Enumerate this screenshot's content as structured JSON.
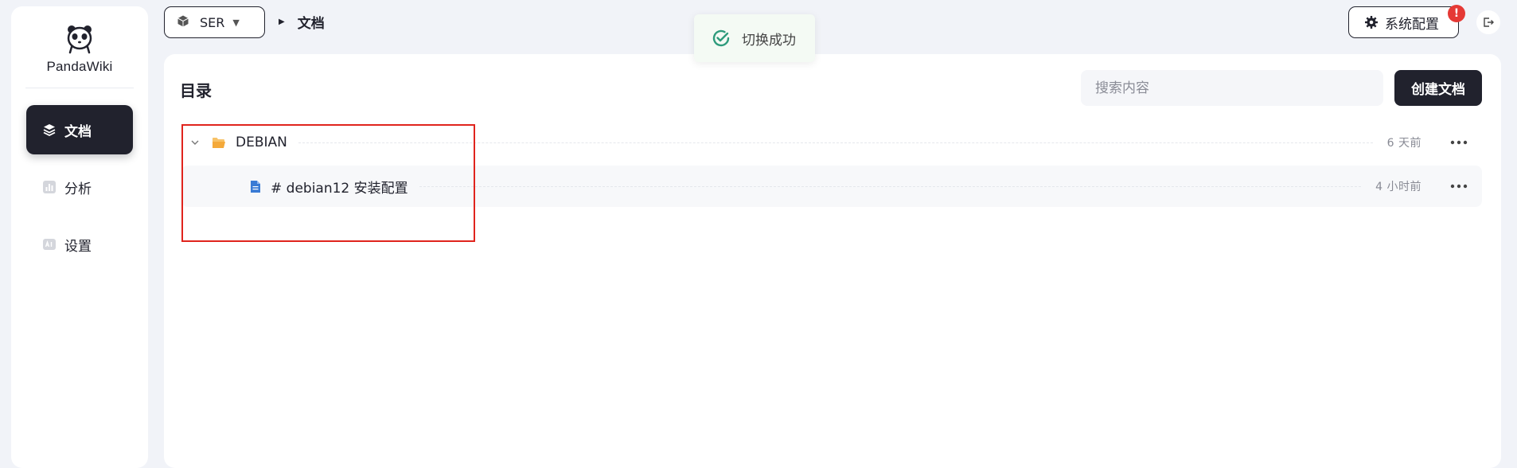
{
  "brand": {
    "name": "PandaWiki"
  },
  "sidebar": {
    "items": [
      {
        "label": "文档",
        "icon": "layers-icon",
        "active": true
      },
      {
        "label": "分析",
        "icon": "bar-chart-icon",
        "active": false
      },
      {
        "label": "设置",
        "icon": "ai-settings-icon",
        "active": false
      }
    ]
  },
  "header": {
    "kb_select": {
      "value": "SER",
      "icon": "cube-icon"
    },
    "breadcrumb": "文档",
    "system_button": "系统配置",
    "system_badge": "!",
    "logout_icon": "logout-icon"
  },
  "toast": {
    "message": "切换成功",
    "icon": "success-check-icon",
    "color": "#2e9b7c"
  },
  "main": {
    "title": "目录",
    "search": {
      "placeholder": "搜索内容",
      "value": ""
    },
    "create_button": "创建文档",
    "tree": [
      {
        "type": "folder",
        "name": "DEBIAN",
        "time": "6 天前",
        "expanded": true,
        "icon": "folder-open-icon"
      },
      {
        "type": "document",
        "name": "# debian12 安装配置",
        "time": "4 小时前",
        "icon": "document-icon"
      }
    ]
  },
  "colors": {
    "accent_dark": "#21222d",
    "highlight_box": "#e0241d",
    "folder": "#f4a93a",
    "document": "#3a7bd5",
    "badge": "#e53935"
  }
}
